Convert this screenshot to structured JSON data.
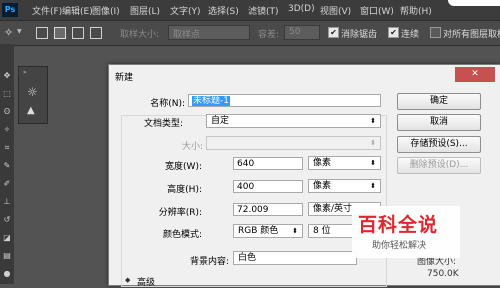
{
  "menubar": {
    "items": [
      "文件(F)",
      "编辑(E)",
      "图像(I)",
      "图层(L)",
      "文字(Y)",
      "选择(S)",
      "滤镜(T)",
      "3D(D)",
      "视图(V)",
      "窗口(W)",
      "帮助(H)"
    ]
  },
  "options": {
    "feather_label": "取样大小:",
    "feather_value": "取样点",
    "tolerance_label": "容差:",
    "tolerance_value": "50",
    "antialias_label": "消除锯齿",
    "contiguous_label": "连续",
    "all_layers_label": "对所有图层取样"
  },
  "dialog": {
    "title": "新建",
    "name_label": "名称(N):",
    "name_value": "未标题-1",
    "doc_type_label": "文档类型:",
    "doc_type_value": "自定",
    "size_label": "大小:",
    "width_label": "宽度(W):",
    "width_value": "640",
    "width_unit": "像素",
    "height_label": "高度(H):",
    "height_value": "400",
    "height_unit": "像素",
    "resolution_label": "分辨率(R):",
    "resolution_value": "72.009",
    "resolution_unit": "像素/英寸",
    "color_mode_label": "颜色模式:",
    "color_mode_value": "RGB 颜色",
    "bit_depth_value": "8 位",
    "background_label": "背景内容:",
    "background_value": "白色",
    "advanced_label": "高级",
    "ok_label": "确定",
    "cancel_label": "取消",
    "save_preset_label": "存储预设(S)...",
    "delete_preset_label": "删除预设(D)...",
    "image_size_label": "图像大小:",
    "image_size_value": "750.0K",
    "close_glyph": "✕"
  },
  "watermark": {
    "title": "百科全说",
    "subtitle": "助你轻松解决"
  },
  "colors": {
    "accent_highlight": "#3399ff",
    "watermark_red": "#e0262f"
  }
}
